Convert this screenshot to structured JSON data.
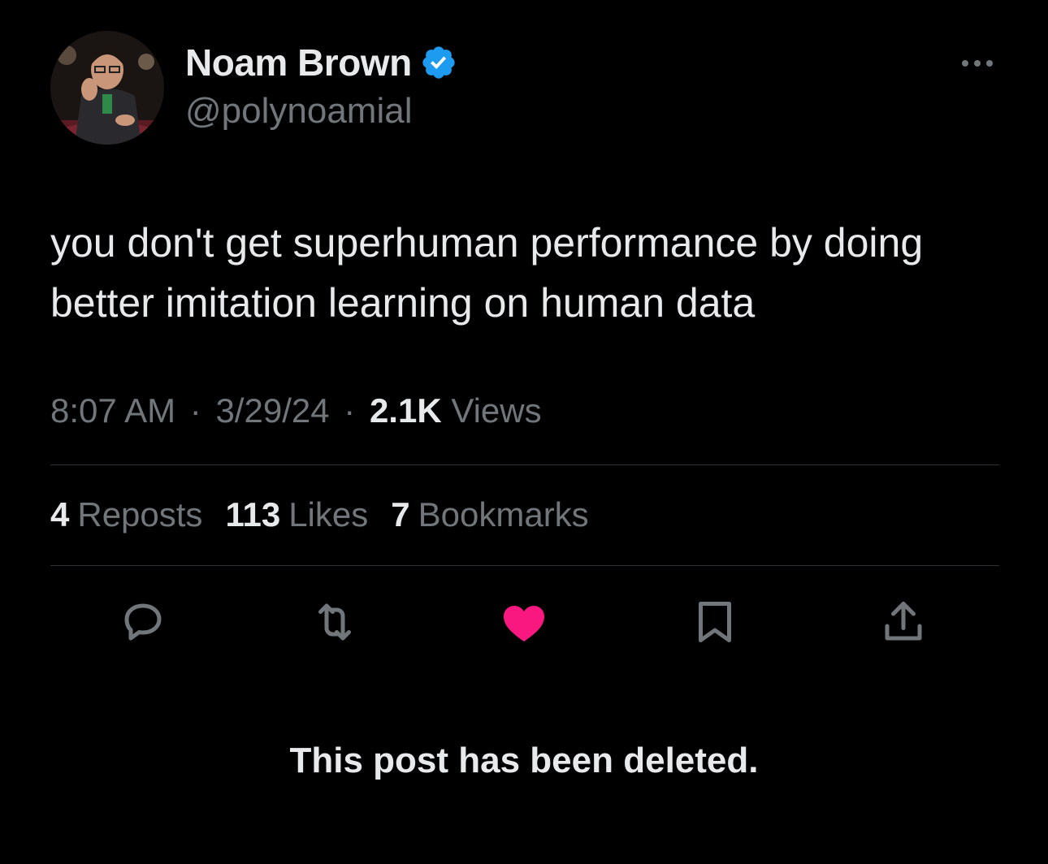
{
  "author": {
    "display_name": "Noam Brown",
    "handle": "@polynoamial",
    "verified_icon": "verified-badge",
    "accent_color": "#1d9bf0"
  },
  "tweet": {
    "text": "you don't get superhuman performance by doing better imitation learning on human data"
  },
  "meta": {
    "time": "8:07 AM",
    "separator": "·",
    "date": "3/29/24",
    "views_count": "2.1K",
    "views_label": "Views"
  },
  "stats": {
    "reposts_count": "4",
    "reposts_label": "Reposts",
    "likes_count": "113",
    "likes_label": "Likes",
    "bookmarks_count": "7",
    "bookmarks_label": "Bookmarks"
  },
  "actions": {
    "reply_icon": "reply-icon",
    "repost_icon": "repost-icon",
    "like_icon": "heart-icon",
    "like_color": "#f91880",
    "bookmark_icon": "bookmark-icon",
    "share_icon": "share-icon",
    "more_icon": "more-dots-icon"
  },
  "notice": {
    "text": "This post has been deleted."
  }
}
